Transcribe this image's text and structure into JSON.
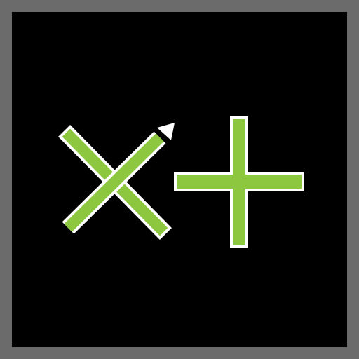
{
  "icon": {
    "name": "pencil-plus-icon",
    "frame_color": "#6b6b6b",
    "tile_color": "#000000",
    "accent_color": "#8dc63f",
    "outline_color": "#ffffff"
  }
}
